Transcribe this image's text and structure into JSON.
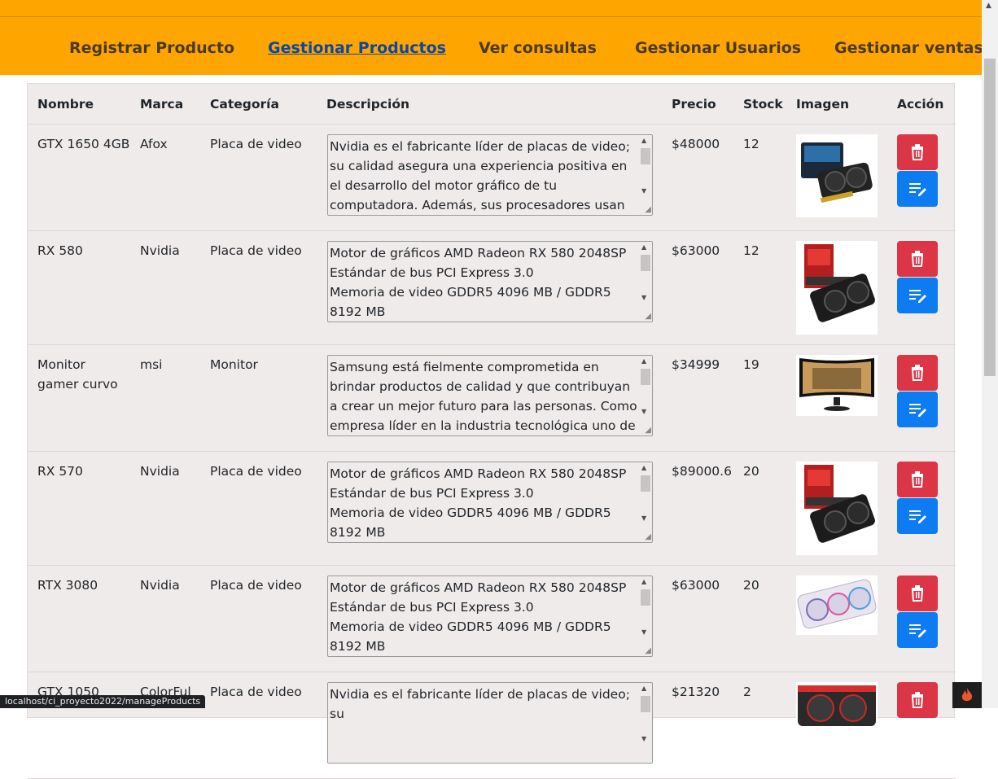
{
  "nav": {
    "items": [
      {
        "label": "Registrar Producto"
      },
      {
        "label": "Gestionar Productos"
      },
      {
        "label": "Ver consultas"
      },
      {
        "label": "Gestionar Usuarios"
      },
      {
        "label": "Gestionar ventas"
      }
    ],
    "active_index": 1
  },
  "table": {
    "headers": [
      "Nombre",
      "Marca",
      "Categoría",
      "Descripción",
      "Precio",
      "Stock",
      "Imagen",
      "Acción"
    ],
    "rows": [
      {
        "nombre": "GTX 1650 4GB",
        "marca": "Afox",
        "categoria": "Placa de video",
        "descripcion": "Nvidia es el fabricante líder de placas de video; su calidad asegura una experiencia positiva en el desarrollo del motor gráfico de tu computadora. Además, sus procesadores usan tecnología de punta",
        "precio": "$48000",
        "stock": "12",
        "image_icon": "gpu-image"
      },
      {
        "nombre": "RX 580",
        "marca": "Nvidia",
        "categoria": "Placa de video",
        "descripcion": "Motor de gráficos AMD Radeon RX 580 2048SP\nEstándar de bus PCI Express 3.0\nMemoria de video GDDR5 4096 MB / GDDR5 8192 MB",
        "precio": "$63000",
        "stock": "12",
        "image_icon": "gpu-image"
      },
      {
        "nombre": "Monitor gamer curvo",
        "marca": "msi",
        "categoria": "Monitor",
        "descripcion": "Samsung está fielmente comprometida en brindar productos de calidad y que contribuyan a crear un mejor futuro para las personas. Como empresa líder en la industria tecnológica uno de sus objetivos",
        "precio": "$34999",
        "stock": "19",
        "image_icon": "monitor-image"
      },
      {
        "nombre": "RX 570",
        "marca": "Nvidia",
        "categoria": "Placa de video",
        "descripcion": "Motor de gráficos AMD Radeon RX 580 2048SP\nEstándar de bus PCI Express 3.0\nMemoria de video GDDR5 4096 MB / GDDR5 8192 MB",
        "precio": "$89000.6",
        "stock": "20",
        "image_icon": "gpu-image"
      },
      {
        "nombre": "RTX 3080",
        "marca": "Nvidia",
        "categoria": "Placa de video",
        "descripcion": "Motor de gráficos AMD Radeon RX 580 2048SP\nEstándar de bus PCI Express 3.0\nMemoria de video GDDR5 4096 MB / GDDR5 8192 MB",
        "precio": "$63000",
        "stock": "20",
        "image_icon": "gpu-image"
      },
      {
        "nombre": "GTX 1050",
        "marca": "ColorFul",
        "categoria": "Placa de video",
        "descripcion": "Nvidia es el fabricante líder de placas de video; su",
        "precio": "$21320",
        "stock": "2",
        "image_icon": "gpu-image"
      }
    ]
  },
  "status_bar": {
    "url": "localhost/ci_proyecto2022/manageProducts"
  },
  "colors": {
    "header_bg": "#ffa500",
    "delete": "#dc3545",
    "edit": "#0d7bf2",
    "active_link": "#0d47a1"
  }
}
